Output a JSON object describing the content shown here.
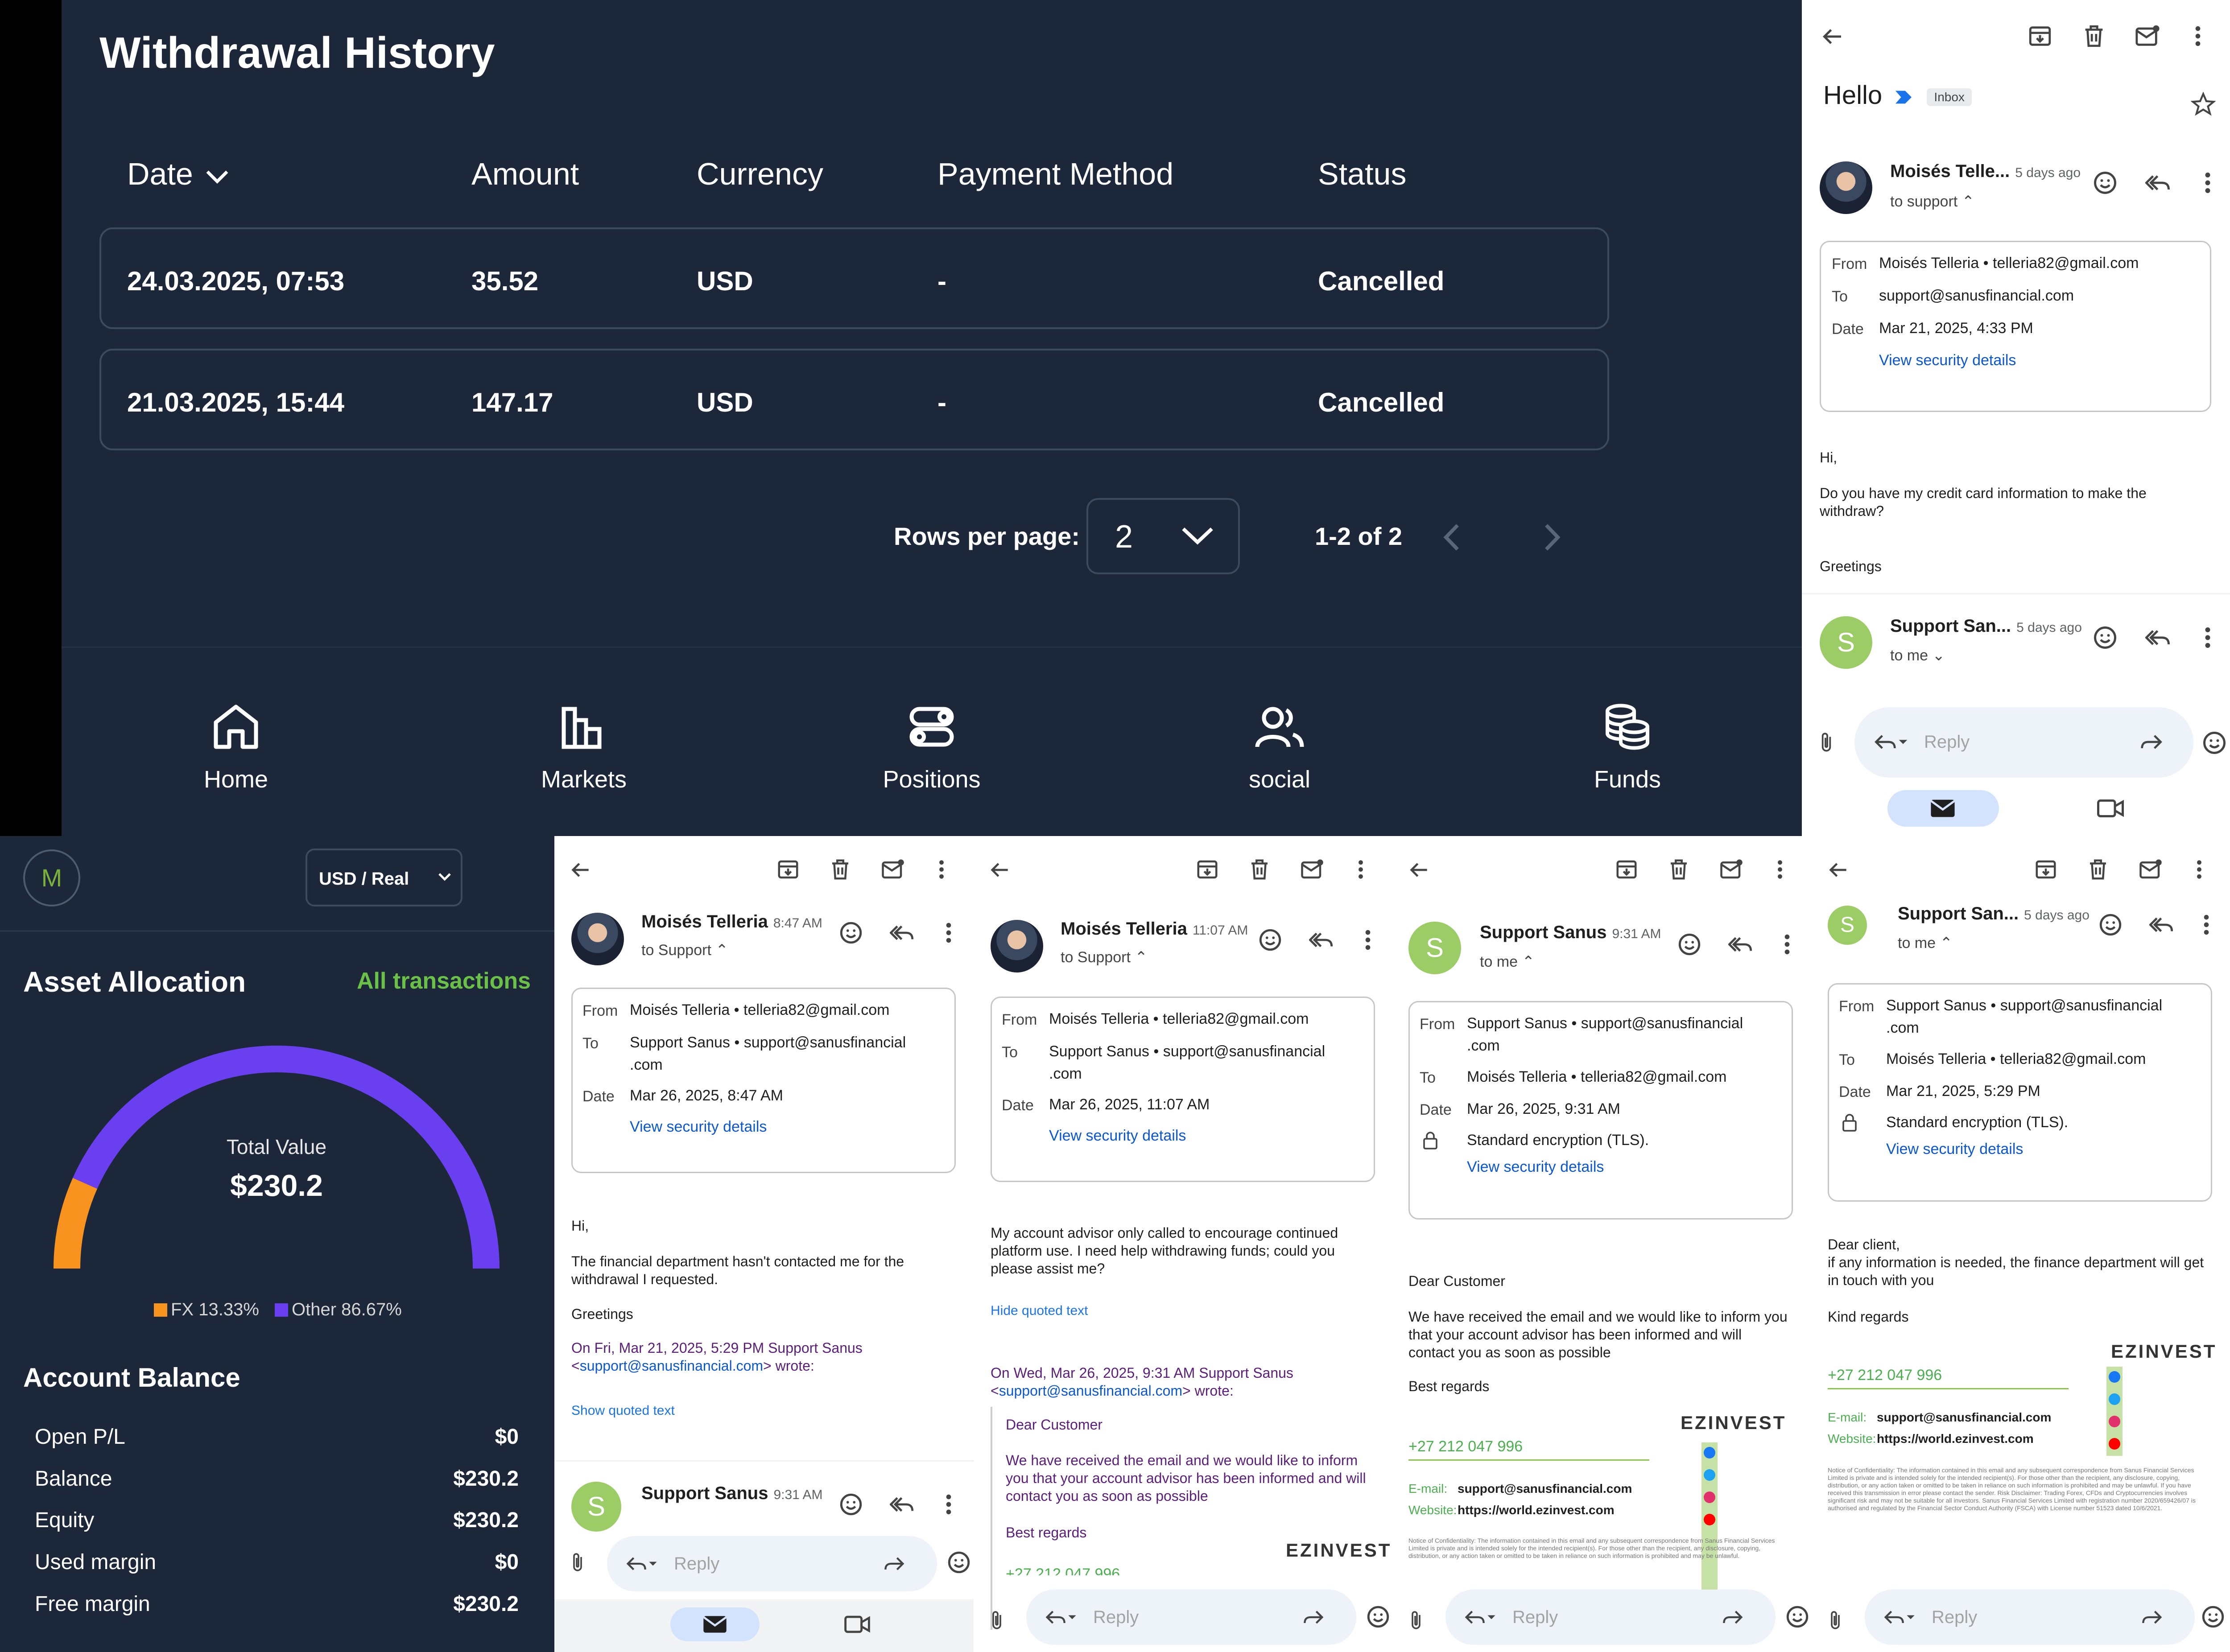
{
  "withdrawal": {
    "title": "Withdrawal History",
    "columns": [
      "Date",
      "Amount",
      "Currency",
      "Payment Method",
      "Status"
    ],
    "rows": [
      {
        "date": "24.03.2025, 07:53",
        "amount": "35.52",
        "currency": "USD",
        "method": "-",
        "status": "Cancelled"
      },
      {
        "date": "21.03.2025, 15:44",
        "amount": "147.17",
        "currency": "USD",
        "method": "-",
        "status": "Cancelled"
      }
    ],
    "pagination": {
      "rows_label": "Rows per page:",
      "rows_value": "2",
      "range": "1-2 of 2"
    },
    "nav": [
      "Home",
      "Markets",
      "Positions",
      "social",
      "Funds"
    ]
  },
  "asset": {
    "avatar_letter": "M",
    "account_select": "USD / Real",
    "title": "Asset Allocation",
    "all_transactions": "All transactions",
    "total_label": "Total Value",
    "total_value": "$230.2",
    "allocation": [
      {
        "name": "FX",
        "percent": 13.33,
        "label": "FX 13.33%",
        "color": "#f7931e"
      },
      {
        "name": "Other",
        "percent": 86.67,
        "label": "Other 86.67%",
        "color": "#6a3ff0"
      }
    ],
    "balance_title": "Account Balance",
    "balance_rows": [
      {
        "label": "Open P/L",
        "value": "$0"
      },
      {
        "label": "Balance",
        "value": "$230.2"
      },
      {
        "label": "Equity",
        "value": "$230.2"
      },
      {
        "label": "Used margin",
        "value": "$0"
      },
      {
        "label": "Free margin",
        "value": "$230.2"
      }
    ]
  },
  "common": {
    "reply_placeholder": "Reply",
    "view_security": "View security details",
    "from_k": "From",
    "to_k": "To",
    "date_k": "Date",
    "tls": "Standard encryption (TLS)."
  },
  "email_hello": {
    "subject": "Hello",
    "label": "Inbox",
    "msg1": {
      "sender": "Moisés Telle...",
      "time": "5 days ago",
      "to": "to support",
      "from": "Moisés Telleria • telleria82@gmail.com",
      "to_addr": "support@sanusfinancial.com",
      "date": "Mar 21, 2025, 4:33 PM"
    },
    "body": [
      "Hi,",
      "Do you have my credit card information to make the withdraw?",
      "Greetings"
    ],
    "msg2": {
      "sender": "Support San...",
      "time": "5 days ago",
      "to": "to me",
      "avatar": "S"
    }
  },
  "email_a": {
    "sender": "Moisés Telleria",
    "time": "8:47 AM",
    "to": "to Support",
    "from": "Moisés Telleria • telleria82@gmail.com",
    "to_addr_1": "Support Sanus • support@sanusfinancial",
    "to_addr_2": ".com",
    "date": "Mar 26, 2025, 8:47 AM",
    "body": [
      "Hi,",
      "The financial department hasn't contacted me for the withdrawal I requested.",
      "Greetings"
    ],
    "quote_1": "On Fri, Mar 21, 2025, 5:29 PM Support Sanus",
    "quote_email": "support@sanusfinancial.com",
    "quote_2": "> wrote:",
    "show_quoted": "Show quoted text",
    "next_sender": "Support Sanus",
    "next_time": "9:31 AM"
  },
  "email_b": {
    "sender": "Moisés Telleria",
    "time": "11:07 AM",
    "to": "to Support",
    "from": "Moisés Telleria • telleria82@gmail.com",
    "to_addr_1": "Support Sanus • support@sanusfinancial",
    "to_addr_2": ".com",
    "date": "Mar 26, 2025, 11:07 AM",
    "body": "My account advisor only called to encourage continued platform use. I need help withdrawing funds; could you please assist me?",
    "hide_quoted": "Hide quoted text",
    "quote_1": "On Wed, Mar 26, 2025, 9:31 AM Support Sanus",
    "quote_email": "support@sanusfinancial.com",
    "quote_2": "> wrote:",
    "q_body": [
      "Dear Customer",
      "We have received the email and we would like to inform you that your account advisor has been informed and will contact you as soon as possible",
      "Best regards"
    ],
    "phone_partial": "+27 212 047 996",
    "logo": "EZINVEST"
  },
  "email_c": {
    "sender": "Support Sanus",
    "time": "9:31 AM",
    "to": "to me",
    "avatar": "S",
    "from_1": "Support Sanus • support@sanusfinancial",
    "from_2": ".com",
    "to_addr": "Moisés Telleria • telleria82@gmail.com",
    "date": "Mar 26, 2025, 9:31 AM",
    "body": [
      "Dear Customer",
      "We have received the email and we would like to inform you that your account advisor has been informed and will contact you as soon as possible",
      "Best regards"
    ],
    "phone": "+27 212 047 996",
    "email_k": "E-mail:",
    "email_v": "support@sanusfinancial.com",
    "web_k": "Website:",
    "web_v": "https://world.ezinvest.com",
    "logo": "EZINVEST",
    "fine": "Notice of Confidentiality: The information contained in this email and any subsequent correspondence from Sanus Financial Services Limited is private and is intended solely for the intended recipient(s). For those other than the recipient, any disclosure, copying, distribution, or any action taken or omitted to be taken in reliance on such information is prohibited and may be unlawful."
  },
  "email_d": {
    "sender": "Support San...",
    "time": "5 days ago",
    "to": "to me",
    "avatar": "S",
    "from_1": "Support Sanus • support@sanusfinancial",
    "from_2": ".com",
    "to_addr": "Moisés Telleria • telleria82@gmail.com",
    "date": "Mar 21, 2025, 5:29 PM",
    "body": [
      "Dear client,",
      "if any information is needed, the finance department will get in touch with you",
      "Kind regards"
    ],
    "phone": "+27 212 047 996",
    "email_k": "E-mail:",
    "email_v": "support@sanusfinancial.com",
    "web_k": "Website:",
    "web_v": "https://world.ezinvest.com",
    "logo": "EZINVEST",
    "fine": "Notice of Confidentiality: The information contained in this email and any subsequent correspondence from Sanus Financial Services Limited is private and is intended solely for the intended recipient(s). For those other than the recipient, any disclosure, copying, distribution, or any action taken or omitted to be taken in reliance on such information is prohibited and may be unlawful. If you have received this transmission in error please contact the sender. Risk Disclaimer: Trading Forex, CFDs and Cryptocurrencies involves significant risk and may not be suitable for all investors. Sanus Financial Services Limited with registration number 2020/659426/07 is authorised and regulated by the Financial Sector Conduct Authority (FSCA) with License number 51523 dated 10/6/2021."
  }
}
